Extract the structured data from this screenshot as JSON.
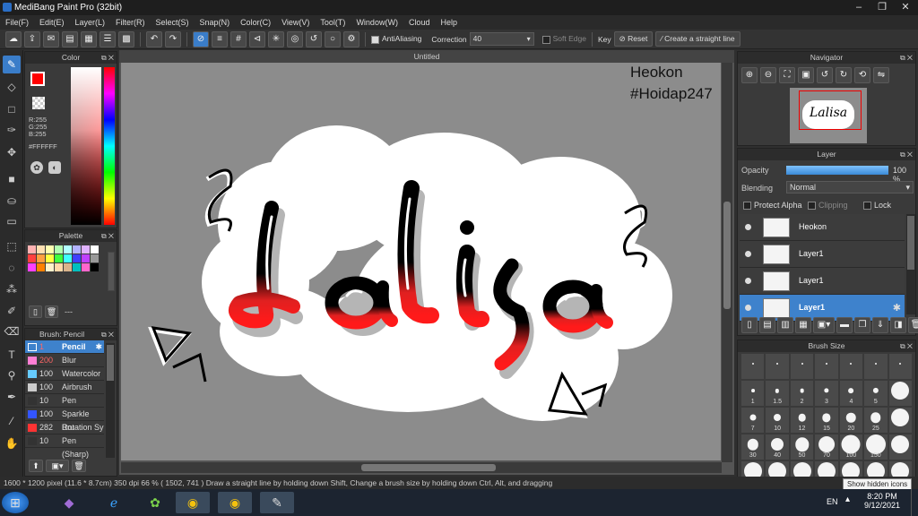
{
  "window": {
    "title": "MediBang Paint Pro (32bit)"
  },
  "menu": [
    "File(F)",
    "Edit(E)",
    "Layer(L)",
    "Filter(R)",
    "Select(S)",
    "Snap(N)",
    "Color(C)",
    "View(V)",
    "Tool(T)",
    "Window(W)",
    "Cloud",
    "Help"
  ],
  "toolbar": {
    "antialiasing_label": "AntiAliasing",
    "correction_label": "Correction",
    "correction_value": "40",
    "soft_edge_label": "Soft Edge",
    "key_label": "Key",
    "reset_label": "Reset",
    "straight_line_label": "Create a straight line"
  },
  "color_panel": {
    "title": "Color",
    "r": "R:255",
    "g": "G:255",
    "b": "B:255",
    "hex": "#FFFFFF"
  },
  "palette_panel": {
    "title": "Palette",
    "footer": "---"
  },
  "brush_panel": {
    "title": "Brush: Pencil",
    "brushes": [
      {
        "size": "1",
        "name": "Pencil",
        "color": "#ff4444"
      },
      {
        "size": "200",
        "name": "Blur",
        "color": "#ff7fd4"
      },
      {
        "size": "100",
        "name": "Watercolor",
        "color": "#66ccff"
      },
      {
        "size": "100",
        "name": "Airbrush",
        "color": "#cccccc"
      },
      {
        "size": "10",
        "name": "Pen",
        "color": "#333333"
      },
      {
        "size": "100",
        "name": "Sparkle Bru",
        "color": "#3355ff"
      },
      {
        "size": "282",
        "name": "Rotation Sy",
        "color": "#ff3333"
      },
      {
        "size": "10",
        "name": "Pen (Sharp)",
        "color": "#333333"
      }
    ]
  },
  "document": {
    "tab_title": "Untitled",
    "watermark_line1": "Heokon",
    "watermark_line2": "#Hoidap247",
    "lettering": "Lalisa"
  },
  "navigator": {
    "title": "Navigator"
  },
  "layer_panel": {
    "title": "Layer",
    "opacity_label": "Opacity",
    "opacity_value": "100 %",
    "opacity_fraction": 1.0,
    "blending_label": "Blending",
    "blending_value": "Normal",
    "protect_alpha_label": "Protect Alpha",
    "clipping_label": "Clipping",
    "lock_label": "Lock",
    "layers": [
      {
        "name": "Heokon",
        "selected": false
      },
      {
        "name": "Layer1",
        "selected": false
      },
      {
        "name": "Layer1",
        "selected": false
      },
      {
        "name": "Layer1",
        "selected": true
      }
    ]
  },
  "brush_size_panel": {
    "title": "Brush Size",
    "sizes": [
      "",
      "",
      "",
      "",
      "",
      "",
      "",
      "1",
      "1.5",
      "2",
      "3",
      "4",
      "5",
      "",
      "7",
      "10",
      "12",
      "15",
      "20",
      "25",
      "",
      "30",
      "40",
      "50",
      "70",
      "100",
      "150",
      "",
      "",
      "",
      "",
      "",
      "",
      "",
      ""
    ]
  },
  "status": {
    "text": "1600 * 1200 pixel  (11.6 * 8.7cm)  350 dpi  66 %  ( 1502, 741 )  Draw a straight line by holding down Shift, Change a brush size by holding down Ctrl, Alt, and dragging",
    "tooltip": "Show hidden icons"
  },
  "taskbar": {
    "lang": "EN",
    "time": "8:20 PM",
    "date": "9/12/2021"
  }
}
